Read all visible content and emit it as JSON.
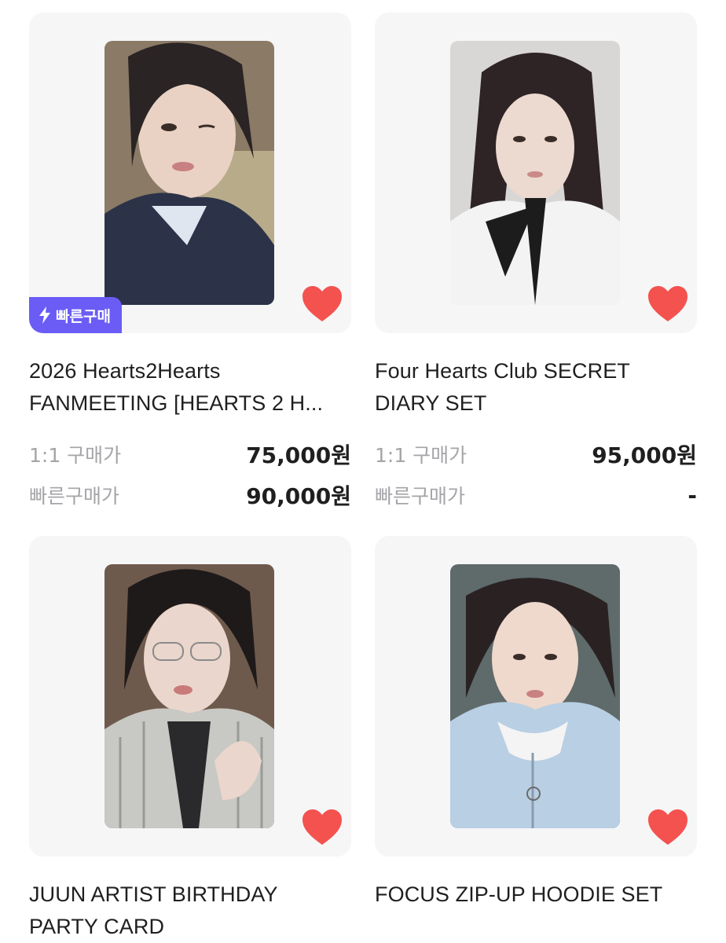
{
  "products": [
    {
      "title_line1": "2026 Hearts2Hearts",
      "title_line2": "FANMEETING [HEARTS 2 H...",
      "has_fast_badge": true,
      "fast_badge_label": "빠른구매",
      "price_1to1_label": "1:1 구매가",
      "price_1to1": "75,000원",
      "price_fast_label": "빠른구매가",
      "price_fast": "90,000원",
      "liked": true
    },
    {
      "title_line1": "Four Hearts Club SECRET",
      "title_line2": "DIARY SET",
      "has_fast_badge": false,
      "price_1to1_label": "1:1 구매가",
      "price_1to1": "95,000원",
      "price_fast_label": "빠른구매가",
      "price_fast": "-",
      "liked": true
    },
    {
      "title_line1": "JUUN ARTIST BIRTHDAY",
      "title_line2": "PARTY CARD",
      "has_fast_badge": false,
      "liked": true
    },
    {
      "title_line1": "FOCUS ZIP-UP HOODIE SET",
      "title_line2": "",
      "has_fast_badge": false,
      "liked": true
    }
  ],
  "colors": {
    "heart": "#f4524f",
    "badge": "#6a5cf5",
    "card_bg": "#f6f6f7",
    "label_gray": "#a5a5a9"
  }
}
